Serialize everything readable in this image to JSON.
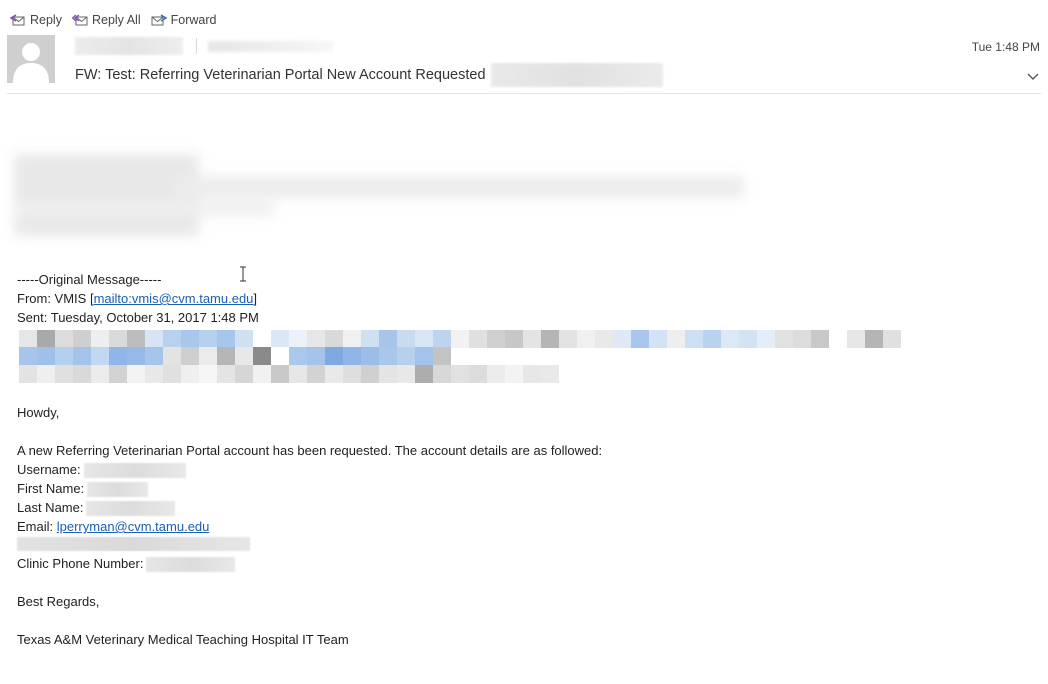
{
  "toolbar": {
    "reply_label": "Reply",
    "reply_all_label": "Reply All",
    "forward_label": "Forward"
  },
  "header": {
    "timestamp": "Tue 1:48 PM",
    "subject": "FW: Test: Referring Veterinarian Portal New Account Requested"
  },
  "original": {
    "separator": "-----Original Message-----",
    "from_label": "From: VMIS [",
    "from_link": "mailto:vmis@cvm.tamu.edu",
    "from_close": "]",
    "sent": "Sent: Tuesday, October 31, 2017 1:48 PM"
  },
  "body": {
    "greeting": "Howdy,",
    "intro": "A new Referring Veterinarian Portal account has been requested. The account details are as followed:",
    "username_label": "Username:",
    "first_name_label": "First Name:",
    "last_name_label": "Last Name:",
    "email_label": "Email:",
    "email_link": "lperryman@cvm.tamu.edu",
    "clinic_phone_label": "Clinic Phone Number:",
    "closing": "Best Regards,",
    "signature": "Texas A&M Veterinary Medical Teaching Hospital IT Team"
  },
  "colors": {
    "link": "#1a5fb4",
    "text": "#1f1f1f"
  }
}
